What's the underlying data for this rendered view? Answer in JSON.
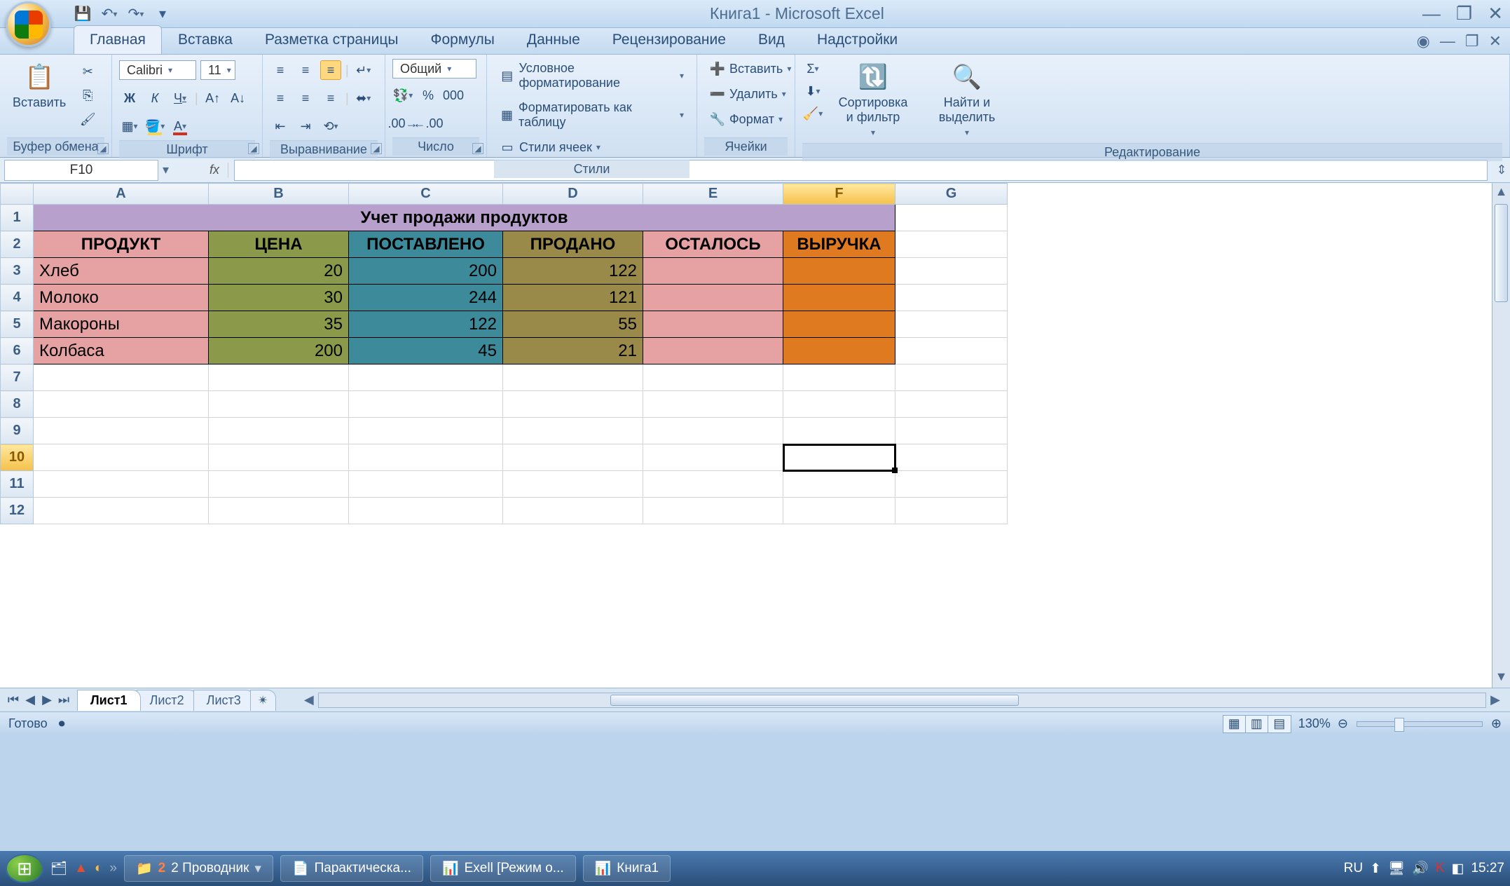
{
  "app": {
    "title": "Книга1 - Microsoft Excel"
  },
  "qat": {
    "save": "💾",
    "undo": "↶",
    "redo": "↷"
  },
  "tabs": {
    "items": [
      "Главная",
      "Вставка",
      "Разметка страницы",
      "Формулы",
      "Данные",
      "Рецензирование",
      "Вид",
      "Надстройки"
    ],
    "active": 0
  },
  "ribbon": {
    "clipboard": {
      "label": "Буфер обмена",
      "paste": "Вставить"
    },
    "font": {
      "label": "Шрифт",
      "name": "Calibri",
      "size": "11",
      "bold": "Ж",
      "italic": "К",
      "underline": "Ч"
    },
    "align": {
      "label": "Выравнивание"
    },
    "number": {
      "label": "Число",
      "format": "Общий",
      "pct": "%",
      "sep": "000"
    },
    "styles": {
      "label": "Стили",
      "cond": "Условное форматирование",
      "table": "Форматировать как таблицу",
      "cell": "Стили ячеек"
    },
    "cells": {
      "label": "Ячейки",
      "ins": "Вставить",
      "del": "Удалить",
      "fmt": "Формат"
    },
    "editing": {
      "label": "Редактирование",
      "sort": "Сортировка и фильтр",
      "find": "Найти и выделить",
      "sum": "Σ"
    }
  },
  "namebox": "F10",
  "fx": "fx",
  "columns": [
    "A",
    "B",
    "C",
    "D",
    "E",
    "F",
    "G"
  ],
  "rows": [
    "1",
    "2",
    "3",
    "4",
    "5",
    "6",
    "7",
    "8",
    "9",
    "10",
    "11",
    "12"
  ],
  "selected": {
    "col": "F",
    "row": "10"
  },
  "sheet": {
    "title": "Учет продажи продуктов",
    "headers": [
      "ПРОДУКТ",
      "ЦЕНА",
      "ПОСТАВЛЕНО",
      "ПРОДАНО",
      "ОСТАЛОСЬ",
      "ВЫРУЧКА"
    ],
    "rows": [
      {
        "p": "Хлеб",
        "price": "20",
        "sup": "200",
        "sold": "122"
      },
      {
        "p": "Молоко",
        "price": "30",
        "sup": "244",
        "sold": "121"
      },
      {
        "p": "Макороны",
        "price": "35",
        "sup": "122",
        "sold": "55"
      },
      {
        "p": "Колбаса",
        "price": "200",
        "sup": "45",
        "sold": "21"
      }
    ]
  },
  "sheets": {
    "items": [
      "Лист1",
      "Лист2",
      "Лист3"
    ],
    "active": 0
  },
  "status": {
    "ready": "Готово",
    "zoom": "130%",
    "lang": "RU",
    "time": "15:27"
  },
  "taskbar": {
    "items": [
      {
        "ic": "📁",
        "t": "2 Проводник"
      },
      {
        "ic": "📄",
        "t": "Парактическа..."
      },
      {
        "ic": "📊",
        "t": "Exell [Режим о..."
      },
      {
        "ic": "📊",
        "t": "Книга1"
      }
    ]
  }
}
